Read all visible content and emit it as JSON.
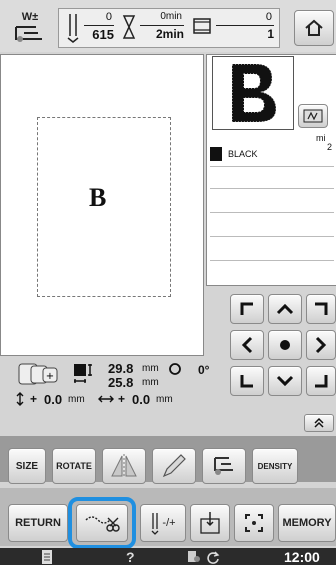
{
  "status_bar": {
    "presser_foot_symbol": "W±",
    "stitch_current": "0",
    "stitch_total": "615",
    "time_elapsed": "0min",
    "time_total": "2min",
    "color_current": "0",
    "color_total": "1"
  },
  "preview": {
    "letter": "B"
  },
  "thread_list": {
    "min_label": "mi",
    "min_value": "2",
    "items": [
      {
        "color_name": "BLACK",
        "swatch": "#111111"
      }
    ]
  },
  "info": {
    "width_value": "29.8",
    "width_unit": "mm",
    "height_value": "25.8",
    "height_unit": "mm",
    "angle": "0°",
    "offset_v_prefix": "+",
    "offset_v_value": "0.0",
    "offset_v_unit": "mm",
    "offset_h_prefix": "+",
    "offset_h_value": "0.0",
    "offset_h_unit": "mm"
  },
  "toolbar1": {
    "size_label": "SIZE",
    "rotate_label": "ROTATE",
    "density_label": "DENSITY"
  },
  "toolbar2": {
    "return_label": "RETURN",
    "needle_label": "-/+",
    "memory_label": "MEMORY"
  },
  "bottom_bar": {
    "help_label": "?",
    "clock": "12:00"
  },
  "colors": {
    "highlight": "#1f8fe0",
    "accent_blue": "#5a9bd4"
  }
}
